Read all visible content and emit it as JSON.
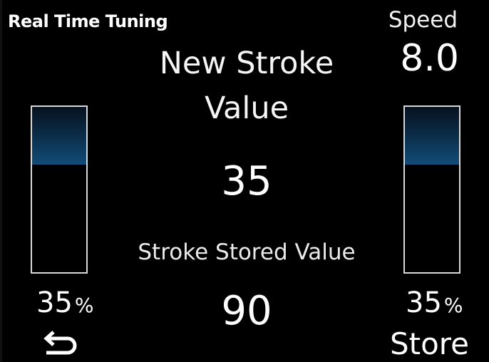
{
  "header": {
    "title": "Real Time Tuning",
    "speed_label": "Speed",
    "speed_value": "8.0"
  },
  "main": {
    "heading_line1": "New Stroke",
    "heading_line2": "Value",
    "new_value": "35",
    "stored_label": "Stroke Stored Value",
    "stored_value": "90"
  },
  "bars": {
    "left": {
      "percent": 35,
      "percent_text": "35",
      "unit": "%"
    },
    "right": {
      "percent": 35,
      "percent_text": "35",
      "unit": "%"
    }
  },
  "footer": {
    "back_icon": "return-arrow-icon",
    "store_label": "Store"
  },
  "colors": {
    "background": "#000000",
    "text": "#ffffff",
    "bar_border": "#d9d9d9",
    "bar_fill": "#124c78"
  }
}
